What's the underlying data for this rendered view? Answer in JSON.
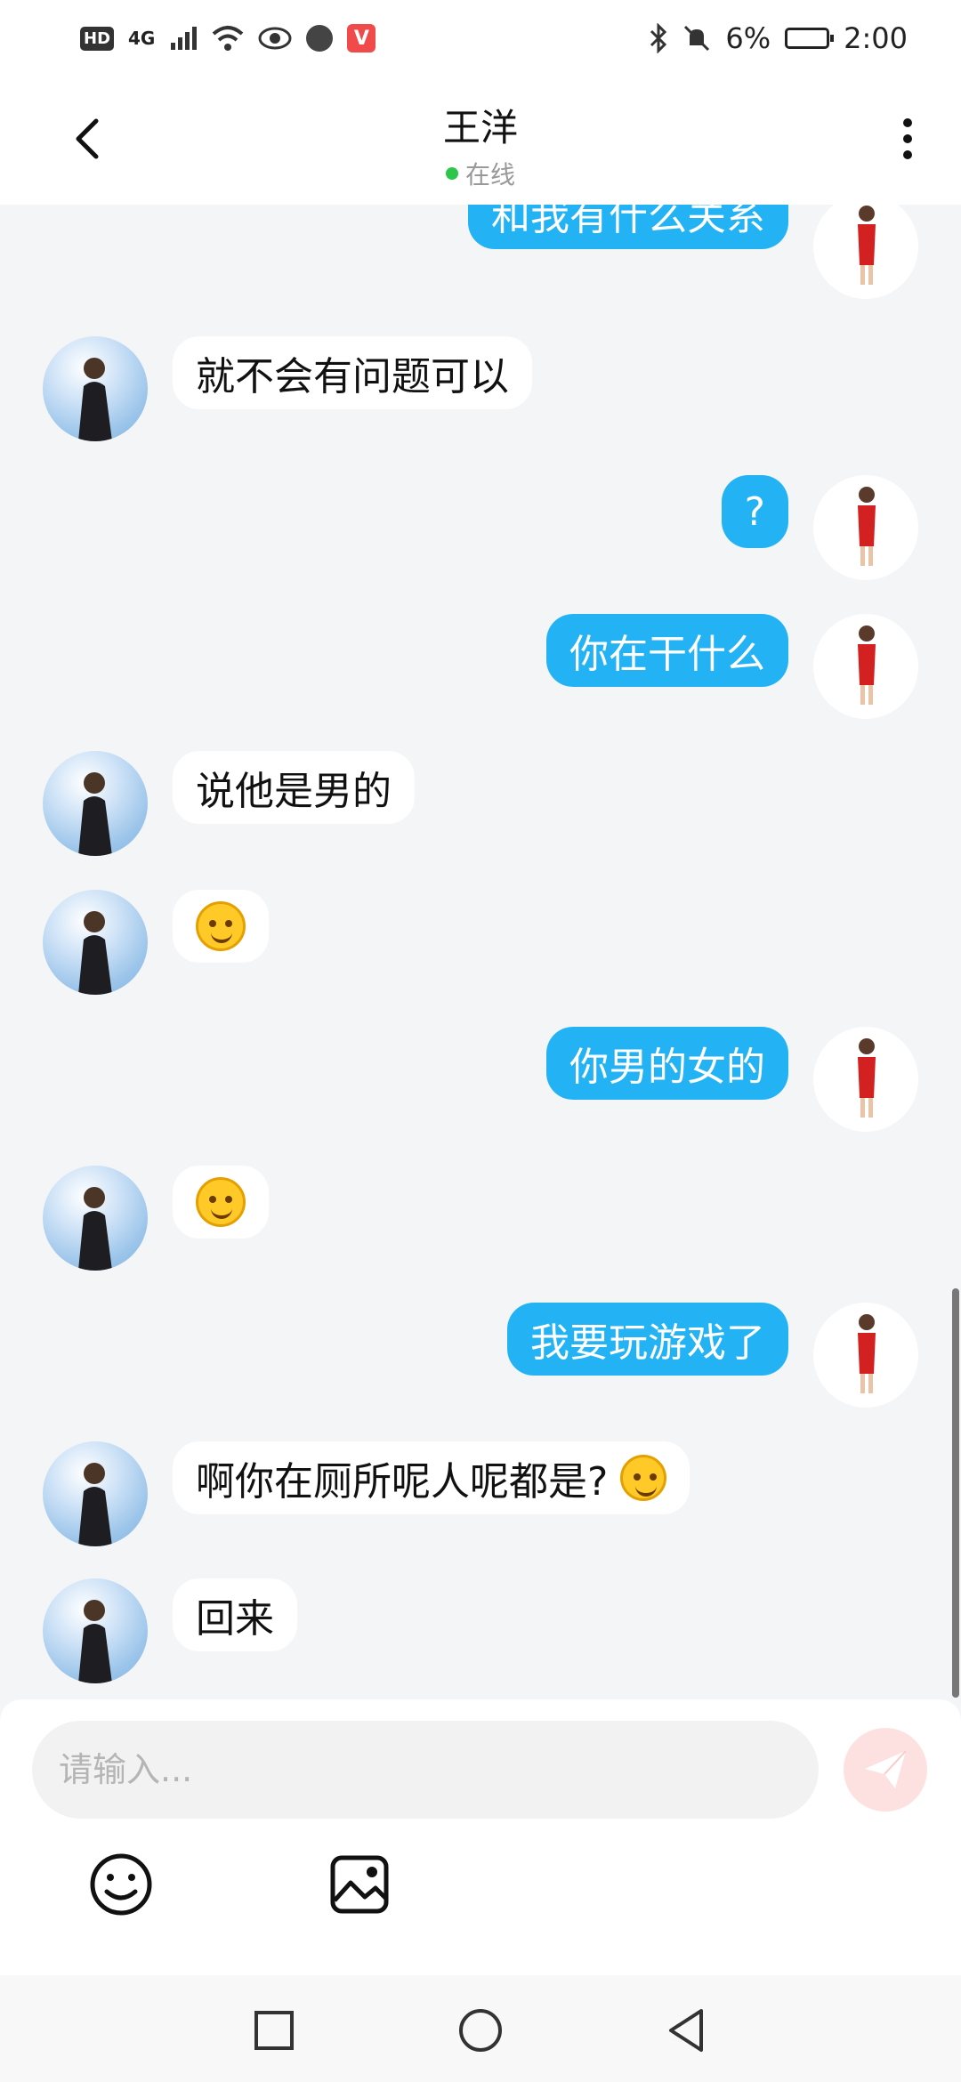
{
  "status_bar": {
    "network": "4G",
    "battery": "6%",
    "time": "2:00",
    "hd_badge": "HD",
    "app_badge": "V"
  },
  "header": {
    "title": "王洋",
    "status": "在线"
  },
  "messages": [
    {
      "side": "right",
      "text": "和我有什么关系"
    },
    {
      "side": "left",
      "text": "就不会有问题可以"
    },
    {
      "side": "right",
      "text": "?"
    },
    {
      "side": "right",
      "text": "你在干什么"
    },
    {
      "side": "left",
      "text": "说他是男的"
    },
    {
      "side": "left",
      "text": "",
      "emoji": "smiling-blush-emoji"
    },
    {
      "side": "right",
      "text": "你男的女的"
    },
    {
      "side": "left",
      "text": "",
      "emoji": "smiling-emoji"
    },
    {
      "side": "right",
      "text": "我要玩游戏了"
    },
    {
      "side": "left",
      "text": "啊你在厕所呢人呢都是?",
      "emoji": "winking-emoji"
    },
    {
      "side": "left",
      "text": "回来"
    }
  ],
  "input": {
    "placeholder": "请输入..."
  },
  "icons": {
    "back": "back-arrow-icon",
    "more": "more-vertical-icon",
    "send": "send-icon",
    "emoji_tool": "emoji-icon",
    "image_tool": "image-icon",
    "nav_recent": "square-icon",
    "nav_home": "circle-icon",
    "nav_back": "triangle-back-icon"
  },
  "colors": {
    "right_bubble": "#23b3f5",
    "left_bubble": "#ffffff",
    "background": "#f4f5f7",
    "online": "#2bc64a",
    "send_button": "#fde1e1"
  }
}
